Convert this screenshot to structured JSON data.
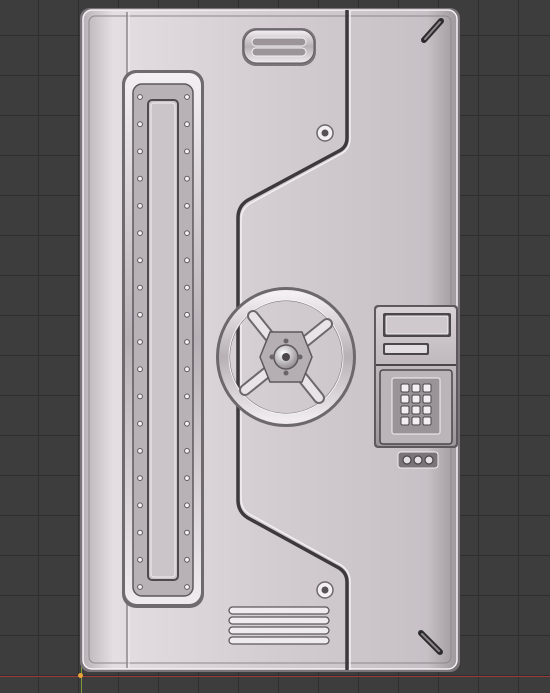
{
  "viewport": {
    "background_color": "#3d3d3d",
    "grid_color": "#2f2f2f",
    "axis_x_color": "#9a3a3a",
    "axis_y_color": "#7d9a3a",
    "origin_color": "#e8a43a"
  },
  "vault_door": {
    "material_color": "#c8c2c6",
    "highlight_color": "#f4f0f3",
    "shadow_color": "#6f6a6e",
    "parts": {
      "top_handle": "grip-handle",
      "left_window": "porthole-strip",
      "wheel": "valve-wheel",
      "panel_display": "display-slot",
      "keypad": "numeric-keypad",
      "indicators": "status-lights",
      "vent": "vent-grille",
      "screws": "screw-icon",
      "slots": "slot-icon"
    },
    "keypad_keys": 12,
    "rivet_count_per_side": 19,
    "vent_slats": 4,
    "indicator_lights": 3
  }
}
